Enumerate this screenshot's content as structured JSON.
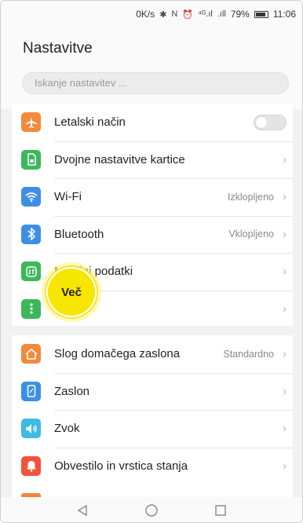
{
  "statusbar": {
    "speed": "0K/s",
    "icons": [
      "bluetooth-icon",
      "nfc-icon",
      "alarm-icon",
      "signal-4g-icon",
      "signal-icon"
    ],
    "battery": "79%",
    "time": "11:06"
  },
  "header": {
    "title": "Nastavitve",
    "search_placeholder": "Iskanje nastavitev ..."
  },
  "group1": [
    {
      "label": "Letalski način",
      "icon": "airplane-icon",
      "color": "#f28a3a",
      "control": "toggle"
    },
    {
      "label": "Dvojne nastavitve kartice",
      "icon": "sim-card-icon",
      "color": "#3cb85a",
      "control": "chevron"
    },
    {
      "label": "Wi-Fi",
      "icon": "wifi-icon",
      "color": "#3d8fe6",
      "value": "Izklopljeno",
      "control": "chevron"
    },
    {
      "label": "Bluetooth",
      "icon": "bluetooth-icon",
      "color": "#3d8fe6",
      "value": "Vklopljeno",
      "control": "chevron"
    },
    {
      "label": "Mobilni podatki",
      "icon": "mobile-data-icon",
      "color": "#3cb85a",
      "control": "chevron"
    },
    {
      "label": "Več",
      "icon": "more-icon",
      "color": "#3cb85a",
      "control": "chevron"
    }
  ],
  "group2": [
    {
      "label": "Slog domačega zaslona",
      "icon": "home-icon",
      "color": "#f28a3a",
      "value": "Standardno",
      "control": "chevron"
    },
    {
      "label": "Zaslon",
      "icon": "display-icon",
      "color": "#3d8fe6",
      "control": "chevron"
    },
    {
      "label": "Zvok",
      "icon": "sound-icon",
      "color": "#3dbbe0",
      "control": "chevron"
    },
    {
      "label": "Obvestilo in vrstica stanja",
      "icon": "notification-icon",
      "color": "#f2533a",
      "control": "chevron"
    }
  ],
  "navbar": [
    "back-icon",
    "home-icon",
    "recents-icon"
  ]
}
